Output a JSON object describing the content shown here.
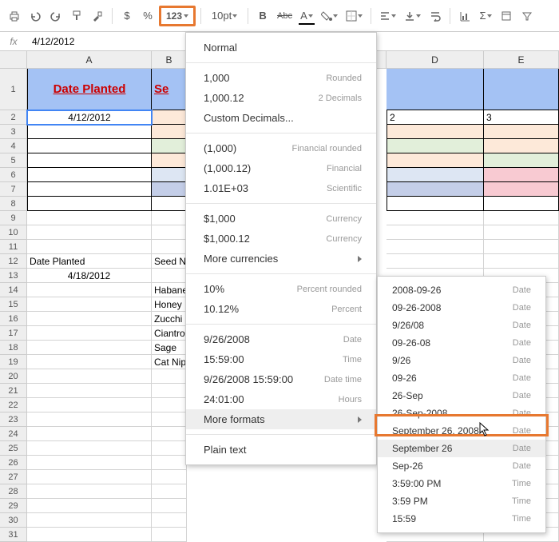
{
  "toolbar": {
    "currency_symbol": "$",
    "percent_symbol": "%",
    "number_format_label": "123",
    "font_size": "10pt",
    "bold": "B",
    "strike": "Abc",
    "text_color": "A",
    "sigma": "Σ"
  },
  "formula_bar": {
    "label": "fx",
    "value": "4/12/2012"
  },
  "columns": [
    "A",
    "B",
    "",
    "D",
    "E"
  ],
  "header_row": {
    "A": "Date Planted",
    "B": "Se"
  },
  "row2": {
    "A": "4/12/2012",
    "D": "2",
    "E": "3"
  },
  "rows_3_8": [
    {
      "d_bg": "#fde9d9",
      "e_bg": "#fde9d9"
    },
    {
      "d_bg": "#e2efda",
      "e_bg": "#fde9d9"
    },
    {
      "d_bg": "#fde9d9",
      "e_bg": "#e2efda"
    },
    {
      "d_bg": "#dde6f3",
      "e_bg": "#f8cad2"
    },
    {
      "d_bg": "#c4cee8",
      "e_bg": "#f8cad2"
    },
    {
      "d_bg": "#ffffff",
      "e_bg": "#ffffff"
    }
  ],
  "row12": {
    "A": "Date Planted",
    "B": "Seed N"
  },
  "row13": {
    "A": "4/18/2012"
  },
  "seed_names": [
    "Habane",
    "Honey",
    "Zucchi",
    "Ciantro",
    "Sage",
    "Cat Nip"
  ],
  "format_menu": [
    {
      "label": "Normal",
      "hint": "",
      "type": "item"
    },
    {
      "type": "sep"
    },
    {
      "label": "1,000",
      "hint": "Rounded",
      "type": "item"
    },
    {
      "label": "1,000.12",
      "hint": "2 Decimals",
      "type": "item"
    },
    {
      "label": "Custom Decimals...",
      "hint": "",
      "type": "item"
    },
    {
      "type": "sep"
    },
    {
      "label": "(1,000)",
      "hint": "Financial rounded",
      "type": "item"
    },
    {
      "label": "(1,000.12)",
      "hint": "Financial",
      "type": "item"
    },
    {
      "label": "1.01E+03",
      "hint": "Scientific",
      "type": "item"
    },
    {
      "type": "sep"
    },
    {
      "label": "$1,000",
      "hint": "Currency",
      "type": "item"
    },
    {
      "label": "$1,000.12",
      "hint": "Currency",
      "type": "item"
    },
    {
      "label": "More currencies",
      "hint": "",
      "type": "submenu"
    },
    {
      "type": "sep"
    },
    {
      "label": "10%",
      "hint": "Percent rounded",
      "type": "item"
    },
    {
      "label": "10.12%",
      "hint": "Percent",
      "type": "item"
    },
    {
      "type": "sep"
    },
    {
      "label": "9/26/2008",
      "hint": "Date",
      "type": "item"
    },
    {
      "label": "15:59:00",
      "hint": "Time",
      "type": "item"
    },
    {
      "label": "9/26/2008 15:59:00",
      "hint": "Date time",
      "type": "item"
    },
    {
      "label": "24:01:00",
      "hint": "Hours",
      "type": "item"
    },
    {
      "label": "More formats",
      "hint": "",
      "type": "submenu",
      "hover": true
    },
    {
      "type": "sep"
    },
    {
      "label": "Plain text",
      "hint": "",
      "type": "item"
    }
  ],
  "more_formats_submenu": [
    {
      "label": "2008-09-26",
      "hint": "Date"
    },
    {
      "label": "09-26-2008",
      "hint": "Date"
    },
    {
      "label": "9/26/08",
      "hint": "Date"
    },
    {
      "label": "09-26-08",
      "hint": "Date"
    },
    {
      "label": "9/26",
      "hint": "Date"
    },
    {
      "label": "09-26",
      "hint": "Date"
    },
    {
      "label": "26-Sep",
      "hint": "Date"
    },
    {
      "label": "26-Sep-2008",
      "hint": "Date"
    },
    {
      "label": "September 26, 2008",
      "hint": "Date"
    },
    {
      "label": "September 26",
      "hint": "Date",
      "selected": true
    },
    {
      "label": "Sep-26",
      "hint": "Date"
    },
    {
      "label": "3:59:00 PM",
      "hint": "Time"
    },
    {
      "label": "3:59 PM",
      "hint": "Time"
    },
    {
      "label": "15:59",
      "hint": "Time"
    }
  ]
}
